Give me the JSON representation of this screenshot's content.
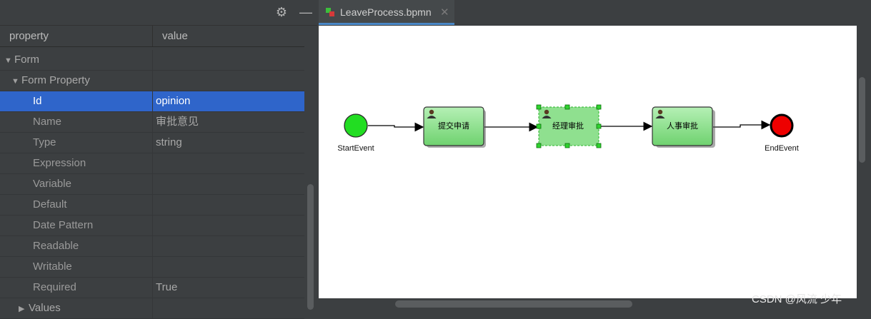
{
  "panel": {
    "columns": {
      "property": "property",
      "value": "value"
    },
    "rows": [
      {
        "label": "Form",
        "value": "",
        "kind": "group",
        "expanded": true
      },
      {
        "label": "Form Property",
        "value": "",
        "kind": "subgroup",
        "expanded": true
      },
      {
        "label": "Id",
        "value": "opinion",
        "kind": "field",
        "selected": true
      },
      {
        "label": "Name",
        "value": "审批意见",
        "kind": "field"
      },
      {
        "label": "Type",
        "value": "string",
        "kind": "field"
      },
      {
        "label": "Expression",
        "value": "",
        "kind": "field"
      },
      {
        "label": "Variable",
        "value": "",
        "kind": "field"
      },
      {
        "label": "Default",
        "value": "",
        "kind": "field"
      },
      {
        "label": "Date Pattern",
        "value": "",
        "kind": "field"
      },
      {
        "label": "Readable",
        "value": "",
        "kind": "field"
      },
      {
        "label": "Writable",
        "value": "",
        "kind": "field"
      },
      {
        "label": "Required",
        "value": "True",
        "kind": "field"
      },
      {
        "label": "Values",
        "value": "",
        "kind": "subgroup",
        "expanded": false
      }
    ],
    "toolbar_icons": [
      "gear-icon",
      "minimize-icon"
    ]
  },
  "editor": {
    "tab_title": "LeaveProcess.bpmn",
    "tab_icon": "bpmn-file-icon"
  },
  "diagram": {
    "start_label": "StartEvent",
    "end_label": "EndEvent",
    "tasks": [
      {
        "label": "提交申请",
        "selected": false
      },
      {
        "label": "经理审批",
        "selected": true
      },
      {
        "label": "人事审批",
        "selected": false
      }
    ],
    "colors": {
      "start": "#22dd22",
      "end": "#ee0000",
      "task_fill": "#8fe08f",
      "task_border": "#3a3a3a"
    }
  },
  "watermark": "CSDN @风流 少年"
}
